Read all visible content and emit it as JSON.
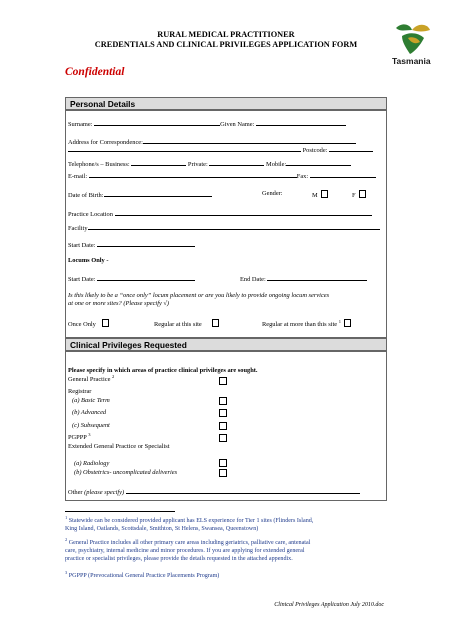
{
  "header": {
    "title_line1": "RURAL MEDICAL PRACTITIONER",
    "title_line2": "CREDENTIALS AND CLINICAL PRIVILEGES APPLICATION FORM",
    "confidential": "Confidential",
    "logo_text": "Tasmania"
  },
  "personal": {
    "heading": "Personal Details",
    "surname": "Surname:",
    "given_name": "Given Name:",
    "address": "Address for Correspondence:",
    "postcode": "Postcode:",
    "telephone": "Telephone/s – Business:",
    "private": "Private:",
    "mobile": "Mobile:",
    "email": "E-mail:",
    "fax": "Fax:",
    "dob": "Date of Birth:",
    "gender": "Gender:",
    "gender_m": "M",
    "gender_f": "F",
    "practice_location": "Practice Location",
    "facility": "Facility",
    "start_date": "Start Date:",
    "locums_only": "Locums Only -",
    "locum_start": "Start Date:",
    "locum_end": "End Date:",
    "question_line1": "Is this likely to be a “once only” locum placement or are you likely to provide ongoing locum services",
    "question_line2": "at one or more sites?   (Please specify √)",
    "once_only": "Once Only",
    "regular_this": "Regular at this site",
    "regular_more": "Regular at more than this site",
    "regular_more_sup": "1"
  },
  "clinical": {
    "heading": "Clinical Privileges Requested",
    "instruction": "Please specify in which areas of practice clinical privileges are sought.",
    "general_practice": "General Practice",
    "general_practice_sup": "2",
    "registrar": "Registrar",
    "basic_term": "(a) Basic Term",
    "advanced": "(b) Advanced",
    "subsequent": "(c) Subsequent",
    "pgppp": "PGPPP",
    "pgppp_sup": "3",
    "extended": "Extended General Practice or Specialist",
    "radiology": "(a) Radiology",
    "obstetrics": "(b) Obstetrics-  uncomplicated deliveries",
    "other": "Other",
    "other_specify": "(please specify)"
  },
  "footnotes": {
    "fn1_num": "1",
    "fn1_line1": "Statewide can be considered provided applicant has ELS experience for Tier 1 sites (Flinders Island,",
    "fn1_line2": "King Island, Oatlands, Scottsdale, Smithton, St Helens, Swansea, Queenstown)",
    "fn2_num": "2",
    "fn2_line1": "General Practice includes all other primary care areas including geriatrics, palliative care, antenatal",
    "fn2_line2": "care, psychiatry, internal medicine and minor procedures.  If you are applying for extended general",
    "fn2_line3": "practice or specialist privileges, please provide the details requested in the attached appendix.",
    "fn3_num": "3",
    "fn3_line1": "PGPPP (Prevocational General Practice Placements Program)"
  },
  "footer": {
    "doc_name": "Clinical Privileges Application July 2010.doc"
  },
  "colors": {
    "section_fill": "#dcdcdc",
    "confidential": "#cc0000",
    "footnote": "#1f3b8c",
    "logo_green": "#2e7d32",
    "logo_gold": "#c9a227"
  }
}
